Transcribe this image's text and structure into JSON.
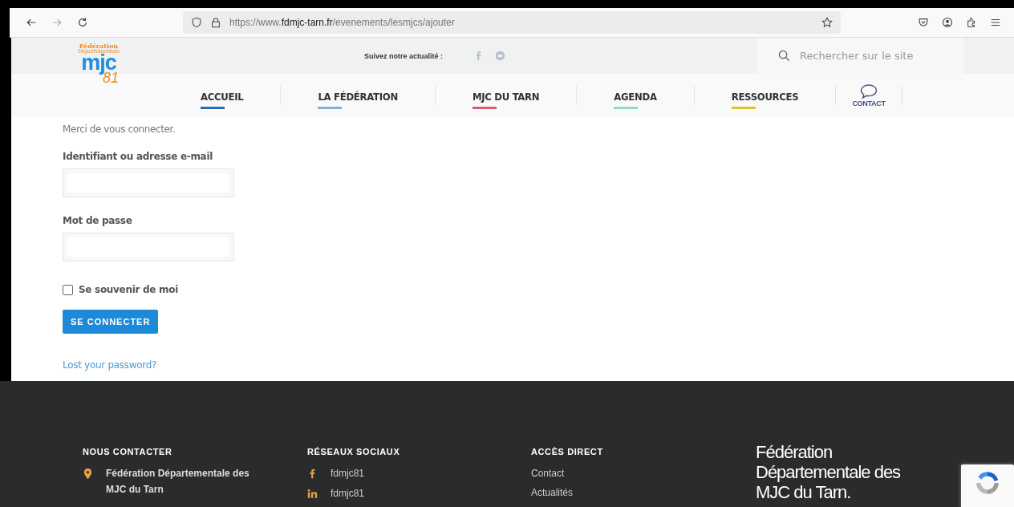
{
  "browser": {
    "url_prefix": "https://www.",
    "url_domain": "fdmjc-tarn.fr",
    "url_path": "/evenements/lesmjcs/ajouter"
  },
  "header": {
    "logo": {
      "line1": "Fédération",
      "line2": "Départementale",
      "mark": "mjc",
      "number": "81"
    },
    "follow_label": "Suivez notre actualité :",
    "search": {
      "placeholder": "Rechercher sur le site"
    }
  },
  "nav": [
    {
      "kind": "link",
      "label": "ACCUEIL",
      "color": "#1f6fb8"
    },
    {
      "kind": "link",
      "label": "LA FÉDÉRATION",
      "color": "#7bb7cc"
    },
    {
      "kind": "link",
      "label": "MJC DU TARN",
      "color": "#e05a6a"
    },
    {
      "kind": "link",
      "label": "AGENDA",
      "color": "#8edcc0"
    },
    {
      "kind": "link",
      "label": "RESSOURCES",
      "color": "#e2c21e"
    },
    {
      "kind": "contact",
      "label": "CONTACT",
      "color": "#4a4f8a"
    }
  ],
  "login": {
    "intro": "Merci de vous connecter.",
    "username_label": "Identifiant ou adresse e-mail",
    "password_label": "Mot de passe",
    "remember": {
      "label": "Se souvenir de moi",
      "checked": false
    },
    "submit": "SE CONNECTER",
    "lost_password": "Lost your password?"
  },
  "footer": {
    "contact": {
      "title": "NOUS CONTACTER",
      "name": "Fédération Départementale des MJC du Tarn"
    },
    "social": {
      "title": "RÉSEAUX SOCIAUX",
      "items": [
        {
          "kind": "facebook",
          "label": "fdmjc81"
        },
        {
          "kind": "linkedin",
          "label": "fdmjc81"
        }
      ]
    },
    "links": {
      "title": "ACCÈS DIRECT",
      "items": [
        "Contact",
        "Actualités"
      ]
    },
    "brand": "Fédération Départementale des MJC du Tarn."
  }
}
